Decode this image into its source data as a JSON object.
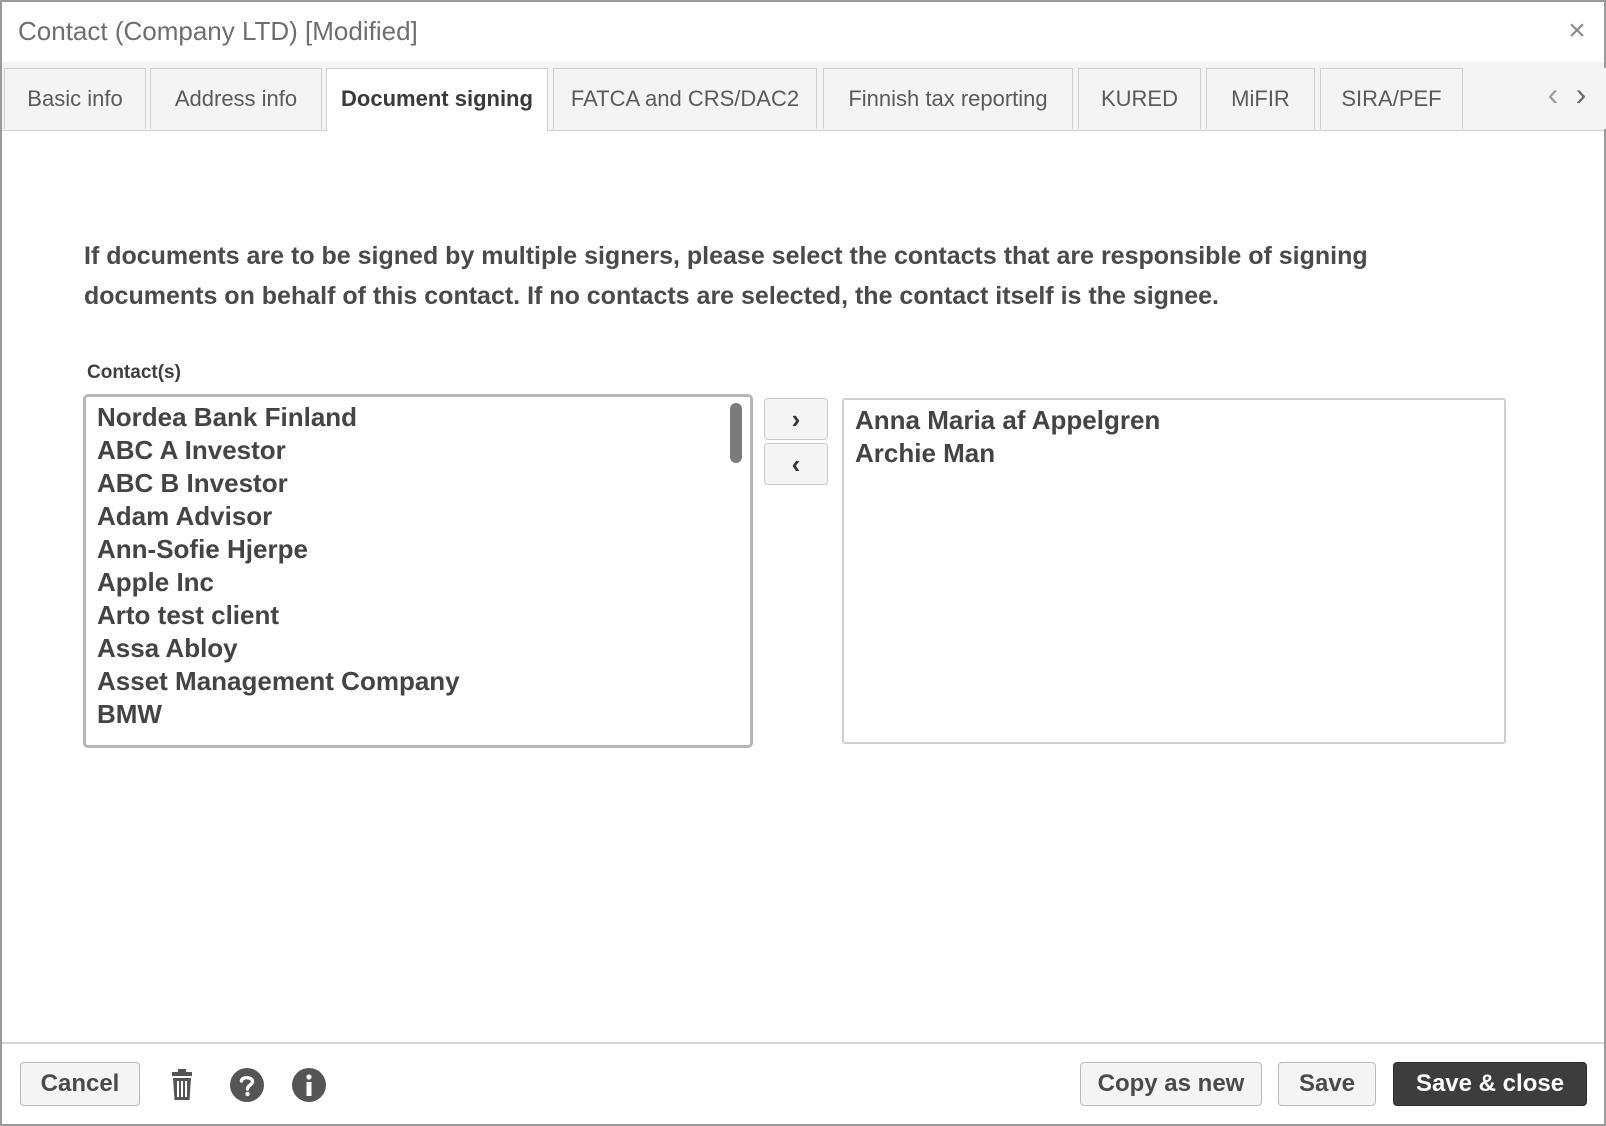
{
  "window": {
    "title": "Contact (Company LTD) [Modified]",
    "close_icon": "×"
  },
  "tabs": [
    {
      "label": "Basic info",
      "active": false
    },
    {
      "label": "Address info",
      "active": false
    },
    {
      "label": "Document signing",
      "active": true
    },
    {
      "label": "FATCA and CRS/DAC2",
      "active": false
    },
    {
      "label": "Finnish tax reporting",
      "active": false
    },
    {
      "label": "KURED",
      "active": false
    },
    {
      "label": "MiFIR",
      "active": false
    },
    {
      "label": "SIRA/PEF",
      "active": false
    }
  ],
  "tab_scroll": {
    "prev": "‹",
    "next": "›"
  },
  "content": {
    "intro": "If documents are to be signed by multiple signers, please select the contacts that are responsible of signing documents on behalf of this contact. If no contacts are selected, the contact itself is the signee.",
    "field_label": "Contact(s)",
    "available_contacts": [
      "Nordea Bank Finland",
      "ABC A Investor",
      "ABC B Investor",
      "Adam Advisor",
      "Ann-Sofie Hjerpe",
      "Apple Inc",
      "Arto test client",
      "Assa Abloy",
      "Asset Management Company",
      "BMW"
    ],
    "selected_contacts": [
      "Anna Maria af Appelgren",
      "Archie Man"
    ],
    "move_right_label": "›",
    "move_left_label": "‹"
  },
  "footer": {
    "cancel": "Cancel",
    "copy_as_new": "Copy as new",
    "save": "Save",
    "save_close": "Save & close",
    "icons": [
      "trash-icon",
      "help-icon",
      "info-icon"
    ]
  },
  "colors": {
    "primary_button": "#3d3d3d",
    "tab_background": "#f4f4f4",
    "border": "#cfcfcf"
  }
}
